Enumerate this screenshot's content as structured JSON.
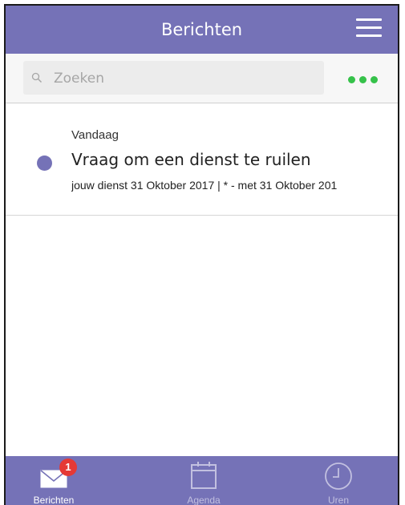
{
  "header": {
    "title": "Berichten",
    "menu_icon": "hamburger-menu-icon"
  },
  "search": {
    "placeholder": "Zoeken",
    "value": "",
    "icon": "search-icon",
    "more_icon": "more-dots-icon"
  },
  "messages": [
    {
      "date": "Vandaag",
      "subject": "Vraag om een dienst te ruilen",
      "preview": "jouw dienst 31 Oktober 2017 | * - met 31 Oktober 201",
      "unread": true
    }
  ],
  "bottom_nav": {
    "tabs": [
      {
        "label": "Berichten",
        "icon": "envelope-icon",
        "badge": "1",
        "active": true
      },
      {
        "label": "Agenda",
        "icon": "calendar-icon",
        "active": false
      },
      {
        "label": "Uren",
        "icon": "clock-icon",
        "active": false
      }
    ]
  },
  "colors": {
    "primary": "#7572b7",
    "more_dots": "#36c24a",
    "badge": "#e53935",
    "unread_dot": "#7572b7"
  }
}
